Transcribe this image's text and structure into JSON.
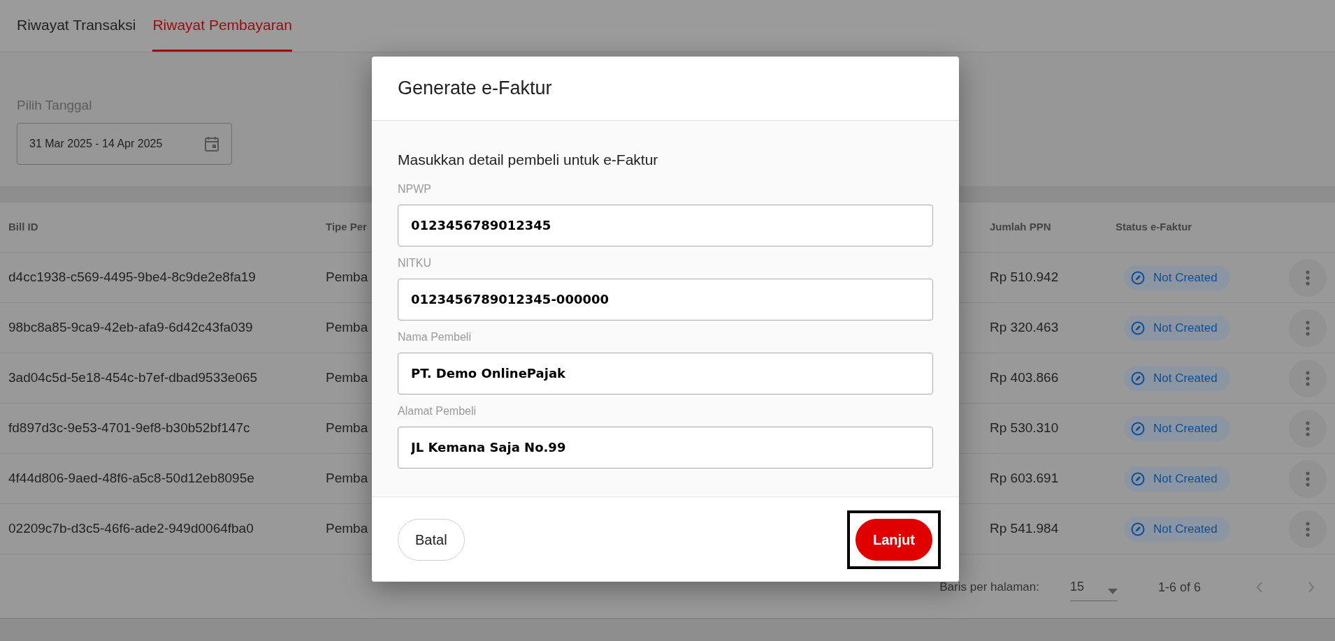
{
  "tabs": [
    {
      "label": "Riwayat Transaksi",
      "selected": false
    },
    {
      "label": "Riwayat Pembayaran",
      "selected": true
    }
  ],
  "date_filter": {
    "label": "Pilih Tanggal",
    "value": "31 Mar 2025 - 14 Apr 2025"
  },
  "table": {
    "columns": [
      "Bill ID",
      "Tipe Per",
      "Jumlah PPN",
      "Status e-Faktur"
    ],
    "rows": [
      {
        "bill_id": "d4cc1938-c569-4495-9be4-8c9de2e8fa19",
        "column_2": "Pemba",
        "ppn": "Rp 510.942",
        "status": "Not Created"
      },
      {
        "bill_id": "98bc8a85-9ca9-42eb-afa9-6d42c43fa039",
        "column_2": "Pemba",
        "ppn": "Rp 320.463",
        "status": "Not Created"
      },
      {
        "bill_id": "3ad04c5d-5e18-454c-b7ef-dbad9533e065",
        "column_2": "Pemba",
        "ppn": "Rp 403.866",
        "status": "Not Created"
      },
      {
        "bill_id": "fd897d3c-9e53-4701-9ef8-b30b52bf147c",
        "column_2": "Pemba",
        "ppn": "Rp 530.310",
        "status": "Not Created"
      },
      {
        "bill_id": "4f44d806-9aed-48f6-a5c8-50d12eb8095e",
        "column_2": "Pemba",
        "ppn": "Rp 603.691",
        "status": "Not Created"
      },
      {
        "bill_id": "02209c7b-d3c5-46f6-ade2-949d0064fba0",
        "column_2": "Pemba",
        "ppn": "Rp 541.984",
        "status": "Not Created"
      }
    ]
  },
  "pagination": {
    "rows_label": "Baris per halaman:",
    "rows_per_page": "15",
    "range": "1-6 of 6"
  },
  "dialog": {
    "title": "Generate e-Faktur",
    "subtitle": "Masukkan detail pembeli untuk e-Faktur",
    "fields": [
      {
        "label": "NPWP",
        "value": "0123456789012345"
      },
      {
        "label": "NITKU",
        "value": "0123456789012345-000000"
      },
      {
        "label": "Nama Pembeli",
        "value": "PT. Demo OnlinePajak"
      },
      {
        "label": "Alamat Pembeli",
        "value": "JL Kemana Saja No.99"
      }
    ],
    "buttons": [
      {
        "kind": "secondary",
        "label": "Batal",
        "highlighted": false
      },
      {
        "kind": "primary",
        "label": "Lanjut",
        "highlighted": true
      }
    ]
  }
}
